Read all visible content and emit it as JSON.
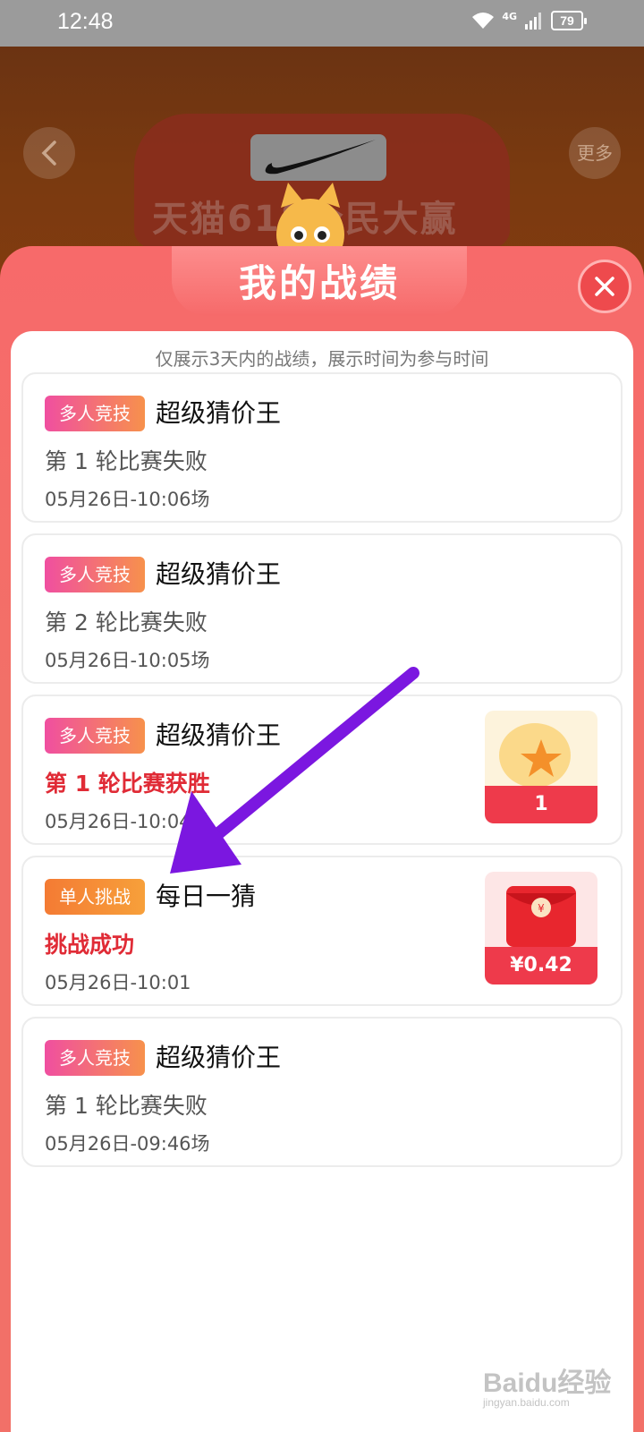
{
  "status_bar": {
    "time": "12:48",
    "network": "4G",
    "battery": "79"
  },
  "background": {
    "more_label": "更多",
    "banner_title": "天猫618全民大赢家"
  },
  "modal": {
    "title": "我的战绩",
    "notice": "仅展示3天内的战绩，展示时间为参与时间"
  },
  "records": [
    {
      "badge": "多人竞技",
      "badge_type": "multi",
      "game": "超级猜价王",
      "status": "第 1 轮比赛失败",
      "status_win": false,
      "time": "05月26日-10:06场"
    },
    {
      "badge": "多人竞技",
      "badge_type": "multi",
      "game": "超级猜价王",
      "status": "第 2 轮比赛失败",
      "status_win": false,
      "time": "05月26日-10:05场"
    },
    {
      "badge": "多人竞技",
      "badge_type": "multi",
      "game": "超级猜价王",
      "status": "第 1 轮比赛获胜",
      "status_win": true,
      "time": "05月26日-10:04场",
      "reward": {
        "icon": "star-icon",
        "label": "1"
      }
    },
    {
      "badge": "单人挑战",
      "badge_type": "single",
      "game": "每日一猜",
      "status": "挑战成功",
      "status_win": true,
      "time": "05月26日-10:01",
      "reward": {
        "icon": "red-envelope-icon",
        "label": "¥0.42"
      }
    },
    {
      "badge": "多人竞技",
      "badge_type": "multi",
      "game": "超级猜价王",
      "status": "第 1 轮比赛失败",
      "status_win": false,
      "time": "05月26日-09:46场"
    }
  ],
  "watermark": {
    "text": "Baidu经验",
    "sub": "jingyan.baidu.com"
  },
  "colors": {
    "modal_bg": "#f27068",
    "win_text": "#e02b36",
    "arrow": "#7b17e0"
  }
}
